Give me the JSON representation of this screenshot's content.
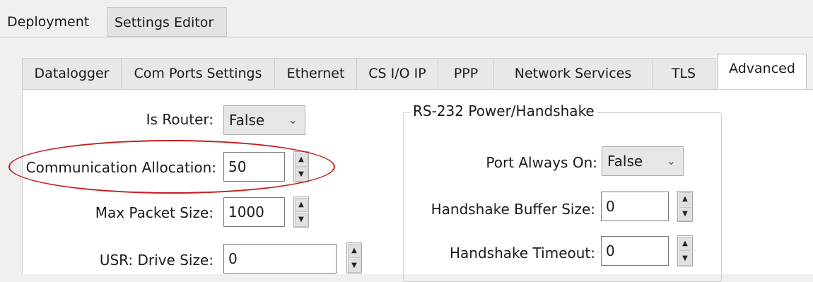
{
  "top_tabs": [
    {
      "label": "Deployment",
      "active": true
    },
    {
      "label": "Settings Editor",
      "active": false
    }
  ],
  "sub_tabs": [
    {
      "label": "Datalogger"
    },
    {
      "label": "Com Ports Settings"
    },
    {
      "label": "Ethernet"
    },
    {
      "label": "CS I/O IP"
    },
    {
      "label": "PPP"
    },
    {
      "label": "Network Services"
    },
    {
      "label": "TLS"
    },
    {
      "label": "Advanced",
      "active": true
    }
  ],
  "left": {
    "is_router": {
      "label": "Is Router:",
      "value": "False"
    },
    "communication_allocation": {
      "label": "Communication Allocation:",
      "value": "50"
    },
    "max_packet_size": {
      "label": "Max Packet Size:",
      "value": "1000"
    },
    "usr_drive_size": {
      "label": "USR: Drive Size:",
      "value": "0"
    }
  },
  "rs232": {
    "title": "RS-232 Power/Handshake",
    "port_always_on": {
      "label": "Port Always On:",
      "value": "False"
    },
    "handshake_buffer_size": {
      "label": "Handshake Buffer Size:",
      "value": "0"
    },
    "handshake_timeout": {
      "label": "Handshake Timeout:",
      "value": "0"
    }
  },
  "icons": {
    "chevron": "chevron-down-icon",
    "spinner_up": "spinner-up-icon",
    "spinner_down": "spinner-down-icon"
  },
  "colors": {
    "highlight": "#c22020",
    "panel": "#ffffff",
    "background": "#f0f0f0"
  }
}
